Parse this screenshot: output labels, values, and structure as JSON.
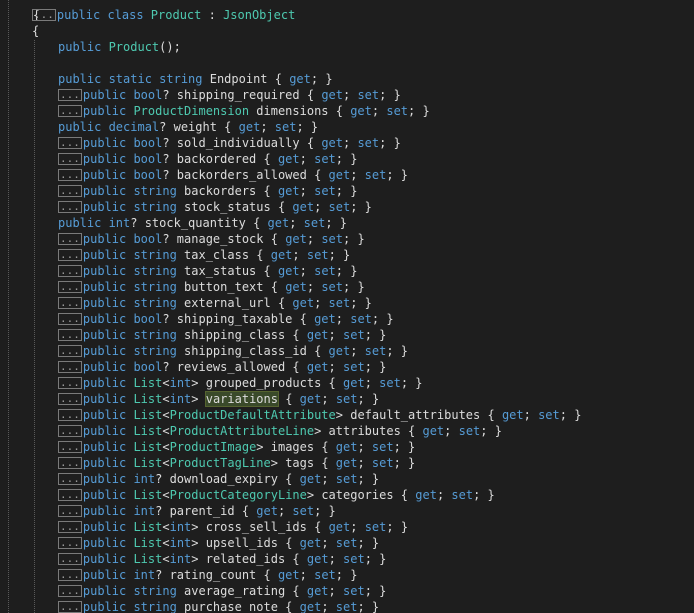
{
  "editor": {
    "open_brace_top": "{",
    "class_open_brace": "{",
    "ellipsis": "...",
    "lines": [
      {
        "segs": [
          [
            "kw",
            "public class "
          ],
          [
            "ty",
            "Product"
          ],
          [
            "pl",
            " : "
          ],
          [
            "ty",
            "JsonObject"
          ]
        ],
        "collapsed": true
      },
      {
        "segs": [
          [
            "pl",
            "{"
          ]
        ]
      },
      {
        "segs": [
          [
            "kw",
            "public "
          ],
          [
            "ty",
            "Product"
          ],
          [
            "pl",
            "();"
          ]
        ]
      },
      {
        "segs": [
          [
            "pl",
            ""
          ]
        ]
      },
      {
        "segs": [
          [
            "kw",
            "public static string "
          ],
          [
            "pl",
            "Endpoint { "
          ],
          [
            "ac",
            "get"
          ],
          [
            "pl",
            "; }"
          ]
        ]
      },
      {
        "segs": [
          [
            "kw",
            "public bool"
          ],
          [
            "pl",
            "? shipping_required { "
          ],
          [
            "ac",
            "get"
          ],
          [
            "pl",
            "; "
          ],
          [
            "ac",
            "set"
          ],
          [
            "pl",
            "; }"
          ]
        ],
        "collapsed": true
      },
      {
        "segs": [
          [
            "kw",
            "public "
          ],
          [
            "ty",
            "ProductDimension"
          ],
          [
            "pl",
            " dimensions { "
          ],
          [
            "ac",
            "get"
          ],
          [
            "pl",
            "; "
          ],
          [
            "ac",
            "set"
          ],
          [
            "pl",
            "; }"
          ]
        ],
        "collapsed": true
      },
      {
        "segs": [
          [
            "kw",
            "public decimal"
          ],
          [
            "pl",
            "? weight { "
          ],
          [
            "ac",
            "get"
          ],
          [
            "pl",
            "; "
          ],
          [
            "ac",
            "set"
          ],
          [
            "pl",
            "; }"
          ]
        ]
      },
      {
        "segs": [
          [
            "kw",
            "public bool"
          ],
          [
            "pl",
            "? sold_individually { "
          ],
          [
            "ac",
            "get"
          ],
          [
            "pl",
            "; "
          ],
          [
            "ac",
            "set"
          ],
          [
            "pl",
            "; }"
          ]
        ],
        "collapsed": true
      },
      {
        "segs": [
          [
            "kw",
            "public bool"
          ],
          [
            "pl",
            "? backordered { "
          ],
          [
            "ac",
            "get"
          ],
          [
            "pl",
            "; "
          ],
          [
            "ac",
            "set"
          ],
          [
            "pl",
            "; }"
          ]
        ],
        "collapsed": true
      },
      {
        "segs": [
          [
            "kw",
            "public bool"
          ],
          [
            "pl",
            "? backorders_allowed { "
          ],
          [
            "ac",
            "get"
          ],
          [
            "pl",
            "; "
          ],
          [
            "ac",
            "set"
          ],
          [
            "pl",
            "; }"
          ]
        ],
        "collapsed": true
      },
      {
        "segs": [
          [
            "kw",
            "public string "
          ],
          [
            "pl",
            "backorders { "
          ],
          [
            "ac",
            "get"
          ],
          [
            "pl",
            "; "
          ],
          [
            "ac",
            "set"
          ],
          [
            "pl",
            "; }"
          ]
        ],
        "collapsed": true
      },
      {
        "segs": [
          [
            "kw",
            "public string "
          ],
          [
            "pl",
            "stock_status { "
          ],
          [
            "ac",
            "get"
          ],
          [
            "pl",
            "; "
          ],
          [
            "ac",
            "set"
          ],
          [
            "pl",
            "; }"
          ]
        ],
        "collapsed": true
      },
      {
        "segs": [
          [
            "kw",
            "public int"
          ],
          [
            "pl",
            "? stock_quantity { "
          ],
          [
            "ac",
            "get"
          ],
          [
            "pl",
            "; "
          ],
          [
            "ac",
            "set"
          ],
          [
            "pl",
            "; }"
          ]
        ]
      },
      {
        "segs": [
          [
            "kw",
            "public bool"
          ],
          [
            "pl",
            "? manage_stock { "
          ],
          [
            "ac",
            "get"
          ],
          [
            "pl",
            "; "
          ],
          [
            "ac",
            "set"
          ],
          [
            "pl",
            "; }"
          ]
        ],
        "collapsed": true
      },
      {
        "segs": [
          [
            "kw",
            "public string "
          ],
          [
            "pl",
            "tax_class { "
          ],
          [
            "ac",
            "get"
          ],
          [
            "pl",
            "; "
          ],
          [
            "ac",
            "set"
          ],
          [
            "pl",
            "; }"
          ]
        ],
        "collapsed": true
      },
      {
        "segs": [
          [
            "kw",
            "public string "
          ],
          [
            "pl",
            "tax_status { "
          ],
          [
            "ac",
            "get"
          ],
          [
            "pl",
            "; "
          ],
          [
            "ac",
            "set"
          ],
          [
            "pl",
            "; }"
          ]
        ],
        "collapsed": true
      },
      {
        "segs": [
          [
            "kw",
            "public string "
          ],
          [
            "pl",
            "button_text { "
          ],
          [
            "ac",
            "get"
          ],
          [
            "pl",
            "; "
          ],
          [
            "ac",
            "set"
          ],
          [
            "pl",
            "; }"
          ]
        ],
        "collapsed": true
      },
      {
        "segs": [
          [
            "kw",
            "public string "
          ],
          [
            "pl",
            "external_url { "
          ],
          [
            "ac",
            "get"
          ],
          [
            "pl",
            "; "
          ],
          [
            "ac",
            "set"
          ],
          [
            "pl",
            "; }"
          ]
        ],
        "collapsed": true
      },
      {
        "segs": [
          [
            "kw",
            "public bool"
          ],
          [
            "pl",
            "? shipping_taxable { "
          ],
          [
            "ac",
            "get"
          ],
          [
            "pl",
            "; "
          ],
          [
            "ac",
            "set"
          ],
          [
            "pl",
            "; }"
          ]
        ],
        "collapsed": true
      },
      {
        "segs": [
          [
            "kw",
            "public string "
          ],
          [
            "pl",
            "shipping_class { "
          ],
          [
            "ac",
            "get"
          ],
          [
            "pl",
            "; "
          ],
          [
            "ac",
            "set"
          ],
          [
            "pl",
            "; }"
          ]
        ],
        "collapsed": true
      },
      {
        "segs": [
          [
            "kw",
            "public string "
          ],
          [
            "pl",
            "shipping_class_id { "
          ],
          [
            "ac",
            "get"
          ],
          [
            "pl",
            "; "
          ],
          [
            "ac",
            "set"
          ],
          [
            "pl",
            "; }"
          ]
        ],
        "collapsed": true
      },
      {
        "segs": [
          [
            "kw",
            "public bool"
          ],
          [
            "pl",
            "? reviews_allowed { "
          ],
          [
            "ac",
            "get"
          ],
          [
            "pl",
            "; "
          ],
          [
            "ac",
            "set"
          ],
          [
            "pl",
            "; }"
          ]
        ],
        "collapsed": true
      },
      {
        "segs": [
          [
            "kw",
            "public "
          ],
          [
            "ty",
            "List"
          ],
          [
            "pl",
            "<"
          ],
          [
            "kw",
            "int"
          ],
          [
            "pl",
            "> grouped_products { "
          ],
          [
            "ac",
            "get"
          ],
          [
            "pl",
            "; "
          ],
          [
            "ac",
            "set"
          ],
          [
            "pl",
            "; }"
          ]
        ],
        "collapsed": true
      },
      {
        "segs": [
          [
            "kw",
            "public "
          ],
          [
            "ty",
            "List"
          ],
          [
            "pl",
            "<"
          ],
          [
            "kw",
            "int"
          ],
          [
            "pl",
            "> "
          ],
          [
            "hl",
            "variations"
          ],
          [
            "pl",
            " { "
          ],
          [
            "ac",
            "get"
          ],
          [
            "pl",
            "; "
          ],
          [
            "ac",
            "set"
          ],
          [
            "pl",
            "; }"
          ]
        ],
        "collapsed": true
      },
      {
        "segs": [
          [
            "kw",
            "public "
          ],
          [
            "ty",
            "List"
          ],
          [
            "pl",
            "<"
          ],
          [
            "ty",
            "ProductDefaultAttribute"
          ],
          [
            "pl",
            "> default_attributes { "
          ],
          [
            "ac",
            "get"
          ],
          [
            "pl",
            "; "
          ],
          [
            "ac",
            "set"
          ],
          [
            "pl",
            "; }"
          ]
        ],
        "collapsed": true
      },
      {
        "segs": [
          [
            "kw",
            "public "
          ],
          [
            "ty",
            "List"
          ],
          [
            "pl",
            "<"
          ],
          [
            "ty",
            "ProductAttributeLine"
          ],
          [
            "pl",
            "> attributes { "
          ],
          [
            "ac",
            "get"
          ],
          [
            "pl",
            "; "
          ],
          [
            "ac",
            "set"
          ],
          [
            "pl",
            "; }"
          ]
        ],
        "collapsed": true
      },
      {
        "segs": [
          [
            "kw",
            "public "
          ],
          [
            "ty",
            "List"
          ],
          [
            "pl",
            "<"
          ],
          [
            "ty",
            "ProductImage"
          ],
          [
            "pl",
            "> images { "
          ],
          [
            "ac",
            "get"
          ],
          [
            "pl",
            "; "
          ],
          [
            "ac",
            "set"
          ],
          [
            "pl",
            "; }"
          ]
        ],
        "collapsed": true
      },
      {
        "segs": [
          [
            "kw",
            "public "
          ],
          [
            "ty",
            "List"
          ],
          [
            "pl",
            "<"
          ],
          [
            "ty",
            "ProductTagLine"
          ],
          [
            "pl",
            "> tags { "
          ],
          [
            "ac",
            "get"
          ],
          [
            "pl",
            "; "
          ],
          [
            "ac",
            "set"
          ],
          [
            "pl",
            "; }"
          ]
        ],
        "collapsed": true
      },
      {
        "segs": [
          [
            "kw",
            "public int"
          ],
          [
            "pl",
            "? download_expiry { "
          ],
          [
            "ac",
            "get"
          ],
          [
            "pl",
            "; "
          ],
          [
            "ac",
            "set"
          ],
          [
            "pl",
            "; }"
          ]
        ],
        "collapsed": true
      },
      {
        "segs": [
          [
            "kw",
            "public "
          ],
          [
            "ty",
            "List"
          ],
          [
            "pl",
            "<"
          ],
          [
            "ty",
            "ProductCategoryLine"
          ],
          [
            "pl",
            "> categories { "
          ],
          [
            "ac",
            "get"
          ],
          [
            "pl",
            "; "
          ],
          [
            "ac",
            "set"
          ],
          [
            "pl",
            "; }"
          ]
        ],
        "collapsed": true
      },
      {
        "segs": [
          [
            "kw",
            "public int"
          ],
          [
            "pl",
            "? parent_id { "
          ],
          [
            "ac",
            "get"
          ],
          [
            "pl",
            "; "
          ],
          [
            "ac",
            "set"
          ],
          [
            "pl",
            "; }"
          ]
        ],
        "collapsed": true
      },
      {
        "segs": [
          [
            "kw",
            "public "
          ],
          [
            "ty",
            "List"
          ],
          [
            "pl",
            "<"
          ],
          [
            "kw",
            "int"
          ],
          [
            "pl",
            "> cross_sell_ids { "
          ],
          [
            "ac",
            "get"
          ],
          [
            "pl",
            "; "
          ],
          [
            "ac",
            "set"
          ],
          [
            "pl",
            "; }"
          ]
        ],
        "collapsed": true
      },
      {
        "segs": [
          [
            "kw",
            "public "
          ],
          [
            "ty",
            "List"
          ],
          [
            "pl",
            "<"
          ],
          [
            "kw",
            "int"
          ],
          [
            "pl",
            "> upsell_ids { "
          ],
          [
            "ac",
            "get"
          ],
          [
            "pl",
            "; "
          ],
          [
            "ac",
            "set"
          ],
          [
            "pl",
            "; }"
          ]
        ],
        "collapsed": true
      },
      {
        "segs": [
          [
            "kw",
            "public "
          ],
          [
            "ty",
            "List"
          ],
          [
            "pl",
            "<"
          ],
          [
            "kw",
            "int"
          ],
          [
            "pl",
            "> related_ids { "
          ],
          [
            "ac",
            "get"
          ],
          [
            "pl",
            "; "
          ],
          [
            "ac",
            "set"
          ],
          [
            "pl",
            "; }"
          ]
        ],
        "collapsed": true
      },
      {
        "segs": [
          [
            "kw",
            "public int"
          ],
          [
            "pl",
            "? rating_count { "
          ],
          [
            "ac",
            "get"
          ],
          [
            "pl",
            "; "
          ],
          [
            "ac",
            "set"
          ],
          [
            "pl",
            "; }"
          ]
        ],
        "collapsed": true
      },
      {
        "segs": [
          [
            "kw",
            "public string "
          ],
          [
            "pl",
            "average_rating { "
          ],
          [
            "ac",
            "get"
          ],
          [
            "pl",
            "; "
          ],
          [
            "ac",
            "set"
          ],
          [
            "pl",
            "; }"
          ]
        ],
        "collapsed": true
      },
      {
        "segs": [
          [
            "kw",
            "public string "
          ],
          [
            "pl",
            "purchase_note { "
          ],
          [
            "ac",
            "get"
          ],
          [
            "pl",
            "; "
          ],
          [
            "ac",
            "set"
          ],
          [
            "pl",
            "; }"
          ]
        ],
        "collapsed": true
      }
    ]
  },
  "colors": {
    "background": "#1e1e1e",
    "keyword": "#569cd6",
    "type": "#4ec9b0",
    "plain": "#dcdcdc",
    "highlight": "#3a4a2a"
  }
}
